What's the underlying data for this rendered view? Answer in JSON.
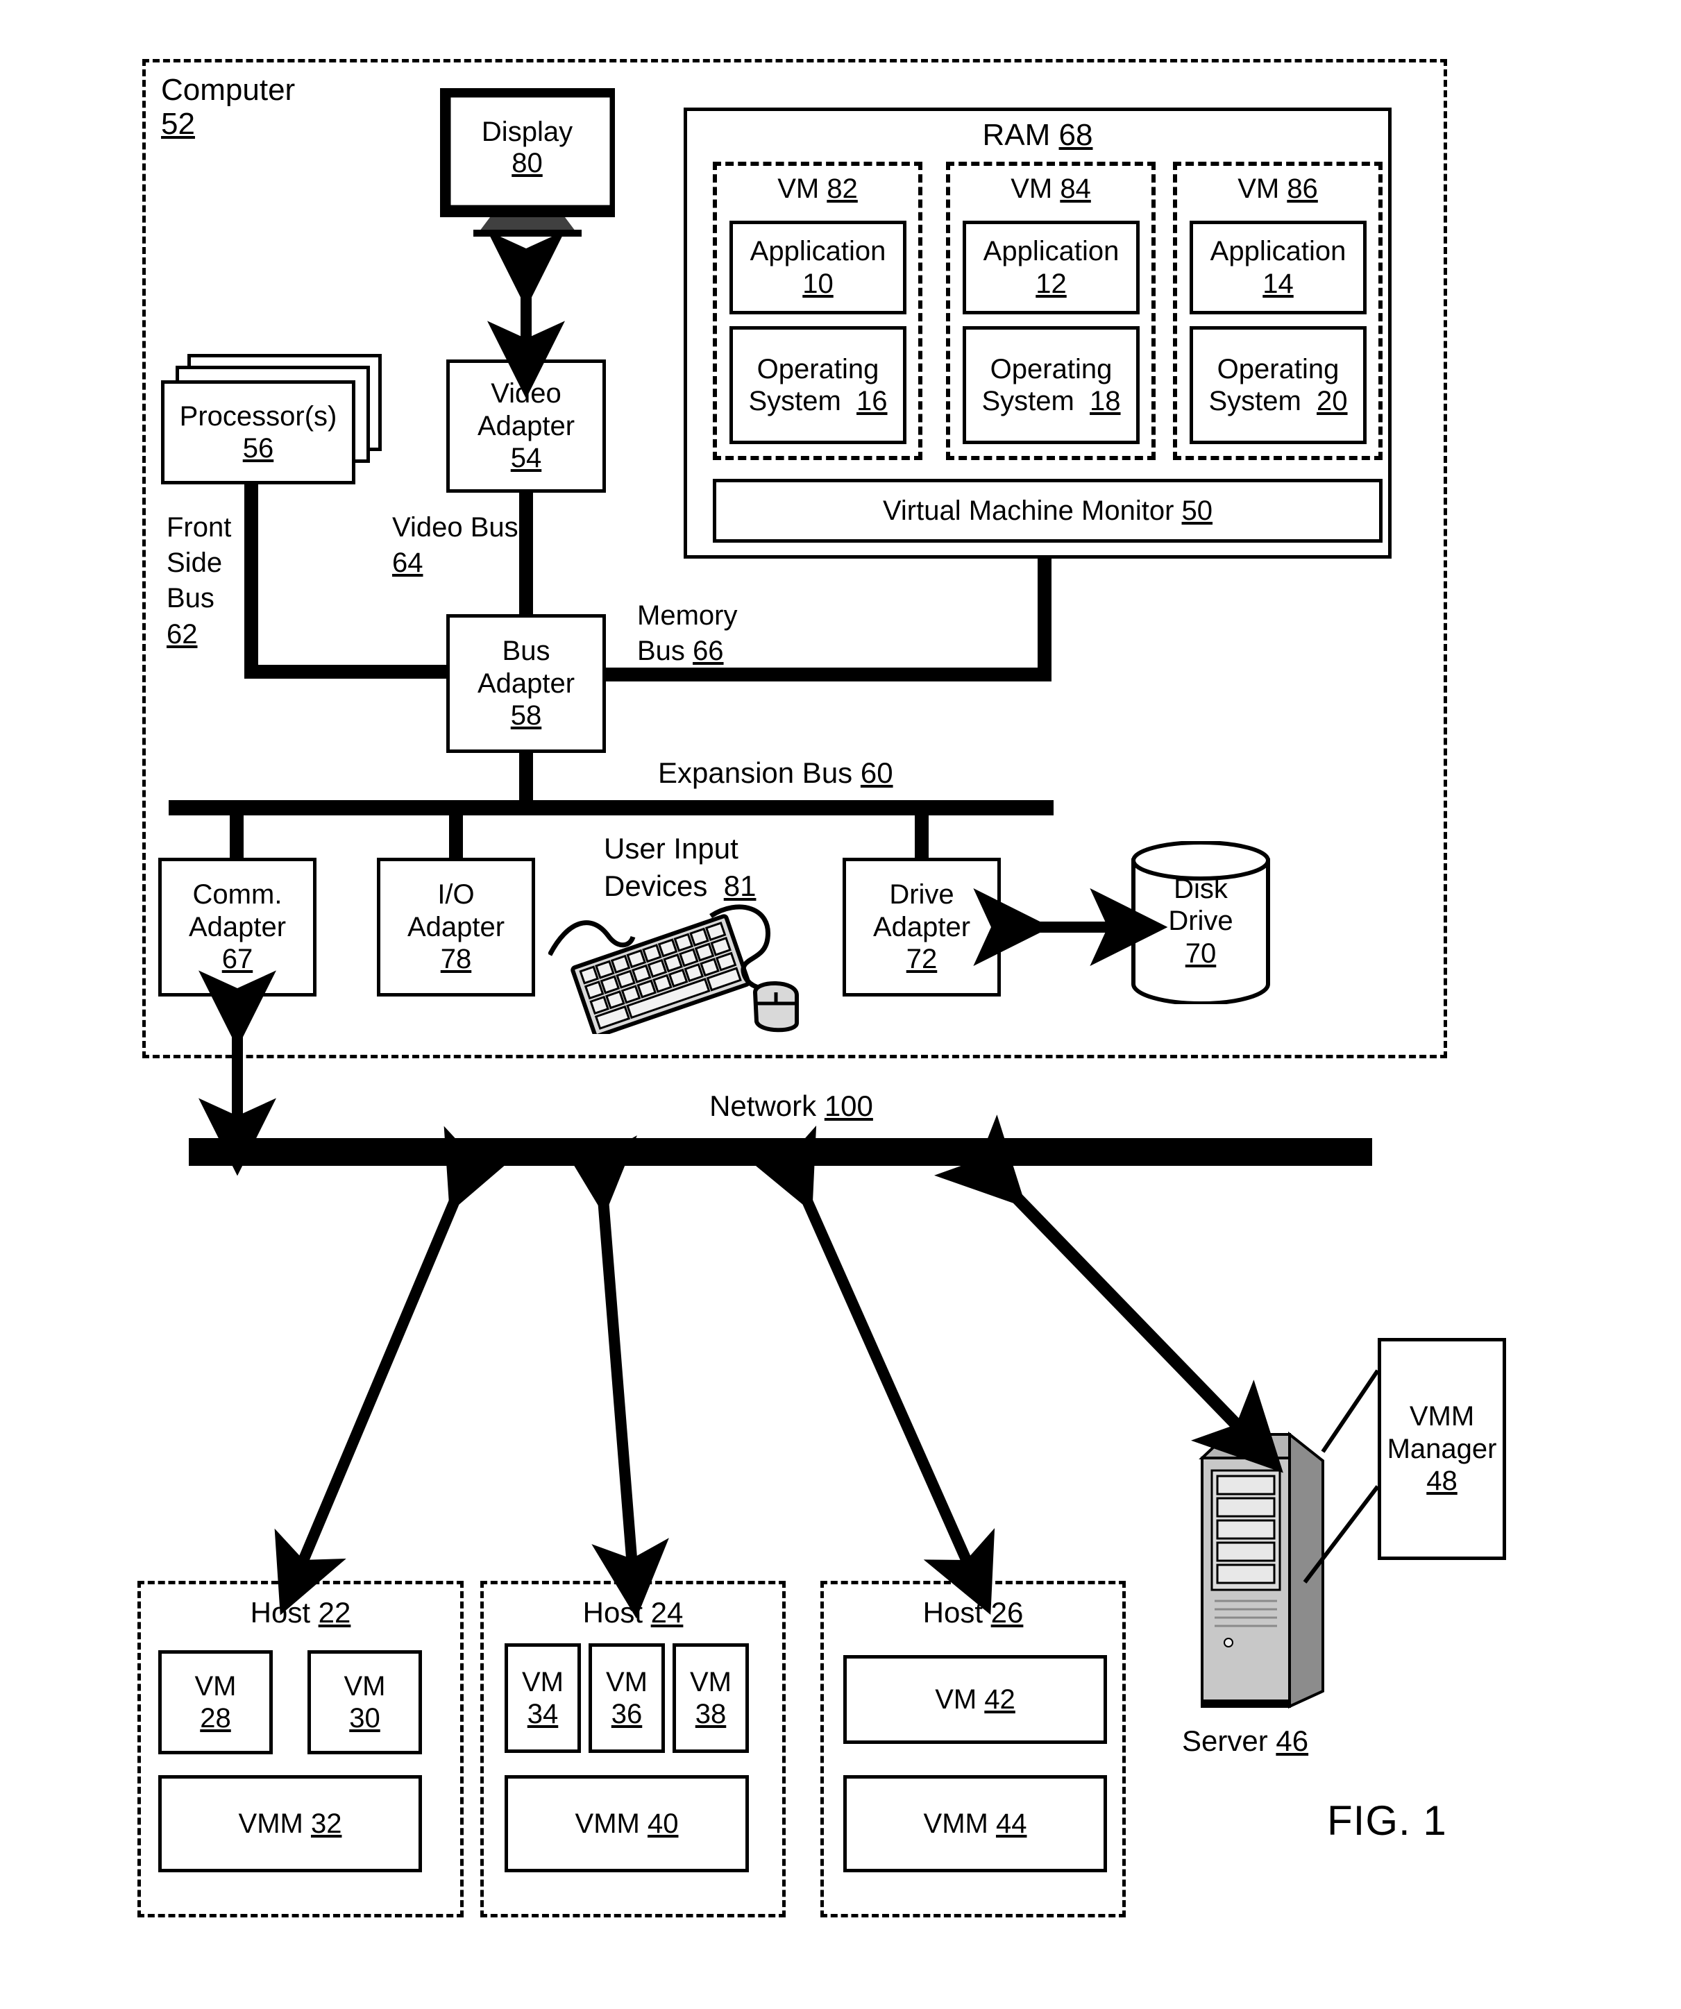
{
  "figure": {
    "label": "FIG. 1"
  },
  "computer": {
    "title": "Computer",
    "ref": "52"
  },
  "display": {
    "title": "Display",
    "ref": "80"
  },
  "processor": {
    "title": "Processor(s)",
    "ref": "56"
  },
  "video_adapter": {
    "title": "Video",
    "title2": "Adapter",
    "ref": "54"
  },
  "bus_adapter": {
    "title": "Bus",
    "title2": "Adapter",
    "ref": "58"
  },
  "buses": {
    "front_side": {
      "l1": "Front",
      "l2": "Side",
      "l3": "Bus",
      "ref": "62"
    },
    "video": {
      "l1": "Video Bus",
      "ref": "64"
    },
    "memory": {
      "l1": "Memory",
      "l2": "Bus",
      "ref": "66"
    },
    "expansion": {
      "l1": "Expansion Bus",
      "ref": "60"
    }
  },
  "ram": {
    "title": "RAM",
    "ref": "68",
    "vms": [
      {
        "name": "VM",
        "ref": "82",
        "app": {
          "title": "Application",
          "ref": "10"
        },
        "os": {
          "l1": "Operating",
          "l2": "System",
          "ref": "16"
        }
      },
      {
        "name": "VM",
        "ref": "84",
        "app": {
          "title": "Application",
          "ref": "12"
        },
        "os": {
          "l1": "Operating",
          "l2": "System",
          "ref": "18"
        }
      },
      {
        "name": "VM",
        "ref": "86",
        "app": {
          "title": "Application",
          "ref": "14"
        },
        "os": {
          "l1": "Operating",
          "l2": "System",
          "ref": "20"
        }
      }
    ],
    "vmm": {
      "title": "Virtual Machine Monitor",
      "ref": "50"
    }
  },
  "comm_adapter": {
    "title": "Comm.",
    "title2": "Adapter",
    "ref": "67"
  },
  "io_adapter": {
    "title": "I/O",
    "title2": "Adapter",
    "ref": "78"
  },
  "user_input": {
    "l1": "User Input",
    "l2": "Devices",
    "ref": "81"
  },
  "drive_adapter": {
    "title": "Drive",
    "title2": "Adapter",
    "ref": "72"
  },
  "disk_drive": {
    "title": "Disk",
    "title2": "Drive",
    "ref": "70"
  },
  "network": {
    "title": "Network",
    "ref": "100"
  },
  "hosts": [
    {
      "title": "Host",
      "ref": "22",
      "vms": [
        {
          "name": "VM",
          "ref": "28"
        },
        {
          "name": "VM",
          "ref": "30"
        }
      ],
      "vmm": {
        "name": "VMM",
        "ref": "32"
      }
    },
    {
      "title": "Host",
      "ref": "24",
      "vms": [
        {
          "name": "VM",
          "ref": "34"
        },
        {
          "name": "VM",
          "ref": "36"
        },
        {
          "name": "VM",
          "ref": "38"
        }
      ],
      "vmm": {
        "name": "VMM",
        "ref": "40"
      }
    },
    {
      "title": "Host",
      "ref": "26",
      "vms": [
        {
          "name": "VM",
          "ref": "42"
        }
      ],
      "vmm": {
        "name": "VMM",
        "ref": "44"
      }
    }
  ],
  "server": {
    "title": "Server",
    "ref": "46"
  },
  "vmm_manager": {
    "l1": "VMM",
    "l2": "Manager",
    "ref": "48"
  },
  "colors": {
    "ink": "#000000",
    "paper": "#ffffff"
  }
}
